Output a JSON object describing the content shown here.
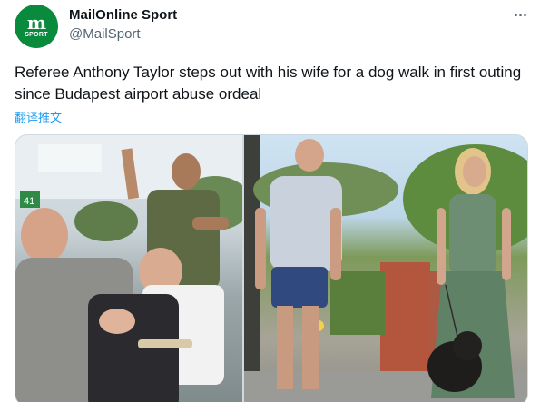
{
  "account": {
    "display_name": "MailOnline Sport",
    "handle": "@MailSport",
    "avatar_monogram": "m",
    "avatar_tag": "SPORT",
    "avatar_color": "#0a8a3c"
  },
  "tweet": {
    "text": "Referee Anthony Taylor steps out with his wife for a dog walk in first outing since Budapest airport abuse ordeal",
    "translate_label": "翻译推文"
  },
  "media": {
    "left_sign": "41",
    "image_count": 2
  },
  "icons": {
    "more": "more-horizontal-icon"
  },
  "colors": {
    "link": "#1d9bf0",
    "secondary_text": "#536471",
    "brand": "#0a8a3c"
  }
}
